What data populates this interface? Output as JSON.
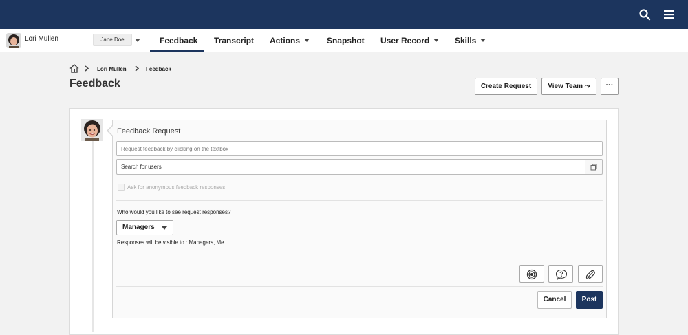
{
  "header": {
    "icons": {
      "search": "search-icon",
      "menu": "hamburger-menu-icon"
    }
  },
  "nav": {
    "user_name": "Lori Mullen",
    "proxy_user": "Jane Doe",
    "items": [
      {
        "label": "Feedback",
        "active": true,
        "dropdown": false
      },
      {
        "label": "Transcript",
        "active": false,
        "dropdown": false
      },
      {
        "label": "Actions",
        "active": false,
        "dropdown": true
      },
      {
        "label": "Snapshot",
        "active": false,
        "dropdown": false
      },
      {
        "label": "User Record",
        "active": false,
        "dropdown": true
      },
      {
        "label": "Skills",
        "active": false,
        "dropdown": true
      }
    ]
  },
  "breadcrumb": {
    "items": [
      {
        "label": "Lori Mullen"
      },
      {
        "label": "Feedback"
      }
    ]
  },
  "page": {
    "title": "Feedback",
    "create_request_label": "Create Request",
    "view_team_label": "View Team ⤳",
    "more_label": "···"
  },
  "form": {
    "title": "Feedback Request",
    "request_placeholder": "Request feedback by clicking on the textbox",
    "search_placeholder": "Search for users",
    "anonymous_label": "Ask for anonymous feedback responses",
    "who_label": "Who would you like to see request responses?",
    "visibility_select": "Managers",
    "visible_to": "Responses will be visible to : Managers, Me",
    "cancel_label": "Cancel",
    "post_label": "Post"
  },
  "colors": {
    "header_bg": "#1c355e",
    "accent": "#1c355e",
    "page_bg": "#f2f2f2"
  }
}
